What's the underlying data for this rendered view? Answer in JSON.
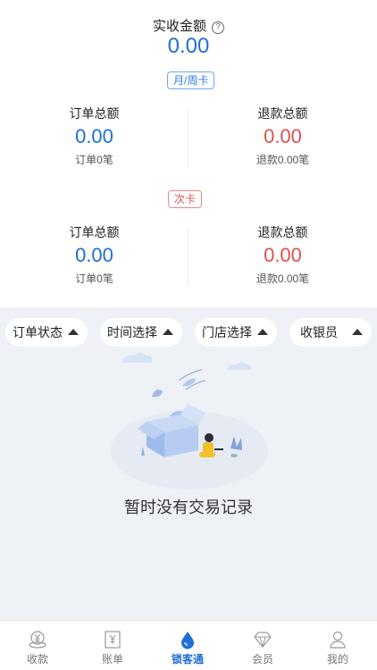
{
  "summary": {
    "total_label": "实收金额",
    "help_icon": "?",
    "total_value": "0.00"
  },
  "monthly_card": {
    "tag": "月/周卡",
    "order_label": "订单总额",
    "order_value": "0.00",
    "order_count": "订单0笔",
    "refund_label": "退款总额",
    "refund_value": "0.00",
    "refund_count": "退款0.00笔"
  },
  "times_card": {
    "tag": "次卡",
    "order_label": "订单总额",
    "order_value": "0.00",
    "order_count": "订单0笔",
    "refund_label": "退款总额",
    "refund_value": "0.00",
    "refund_count": "退款0.00笔"
  },
  "filters": {
    "order_status": "订单状态",
    "time_select": "时间选择",
    "store_select": "门店选择",
    "cashier": "收银员"
  },
  "empty": {
    "message": "暂时没有交易记录"
  },
  "tabbar": {
    "items": [
      {
        "label": "收款",
        "icon": "yen-coin-icon"
      },
      {
        "label": "账单",
        "icon": "bill-icon"
      },
      {
        "label": "锁客通",
        "icon": "drop-icon"
      },
      {
        "label": "会员",
        "icon": "diamond-icon"
      },
      {
        "label": "我的",
        "icon": "person-icon"
      }
    ]
  },
  "colors": {
    "accent_blue": "#1f6fd6",
    "refund_red": "#e0504d",
    "background_gray": "#eef1f6"
  }
}
